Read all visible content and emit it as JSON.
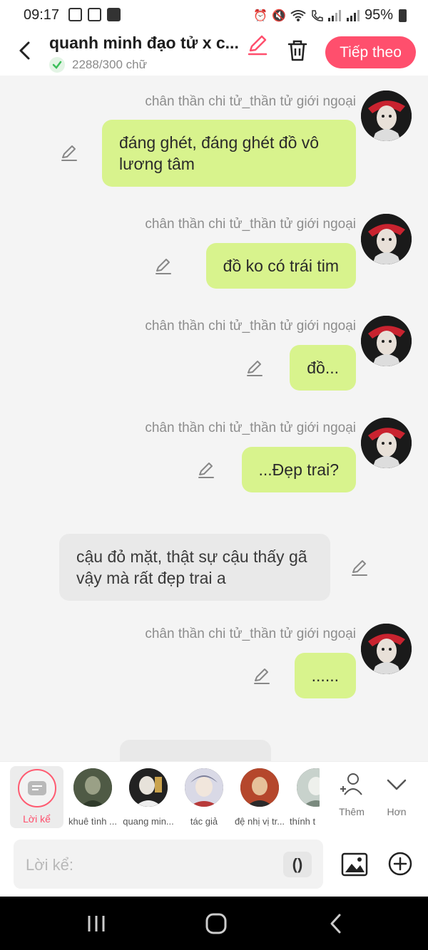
{
  "status_bar": {
    "time": "09:17",
    "battery": "95%",
    "left_icons": [
      "image-icon",
      "apps-icon",
      "video-icon"
    ],
    "right_icons": [
      "alarm-icon",
      "mute-icon",
      "wifi-icon",
      "call-icon",
      "signal-icon",
      "signal-icon"
    ]
  },
  "header": {
    "title": "quanh minh đạo tử x c...",
    "word_count": "2288/300 chữ",
    "next_button": "Tiếp theo"
  },
  "messages": [
    {
      "sender": "chân thần chi tử_thần tử giới ngoại",
      "text": "đáng ghét, đáng ghét đồ vô lương tâm",
      "side": "right"
    },
    {
      "sender": "chân thần chi tử_thần tử giới ngoại",
      "text": "đồ ko có trái tim",
      "side": "right"
    },
    {
      "sender": "chân thần chi tử_thần tử giới ngoại",
      "text": "đồ...",
      "side": "right"
    },
    {
      "sender": "chân thần chi tử_thần tử giới ngoại",
      "text": "...Đẹp trai?",
      "side": "right"
    },
    {
      "sender": "",
      "text": "cậu đỏ mặt, thật sự cậu thấy gã vậy mà rất đẹp trai a",
      "side": "left"
    },
    {
      "sender": "chân thần chi tử_thần tử giới ngoại",
      "text": "......",
      "side": "right"
    }
  ],
  "characters": [
    {
      "name": "Lời kể",
      "selected": true
    },
    {
      "name": "khuê tình ..."
    },
    {
      "name": "quang min..."
    },
    {
      "name": "tác giả"
    },
    {
      "name": "đệ nhị vị tr..."
    },
    {
      "name": "thính t"
    }
  ],
  "tools": {
    "add_label": "Thêm",
    "more_label": "Hơn"
  },
  "input": {
    "placeholder": "Lời kể:",
    "paren_label": "()"
  },
  "colors": {
    "accent": "#ff4f6d",
    "bubble_out": "#d8f38d",
    "bubble_in": "#e9e9e9"
  }
}
